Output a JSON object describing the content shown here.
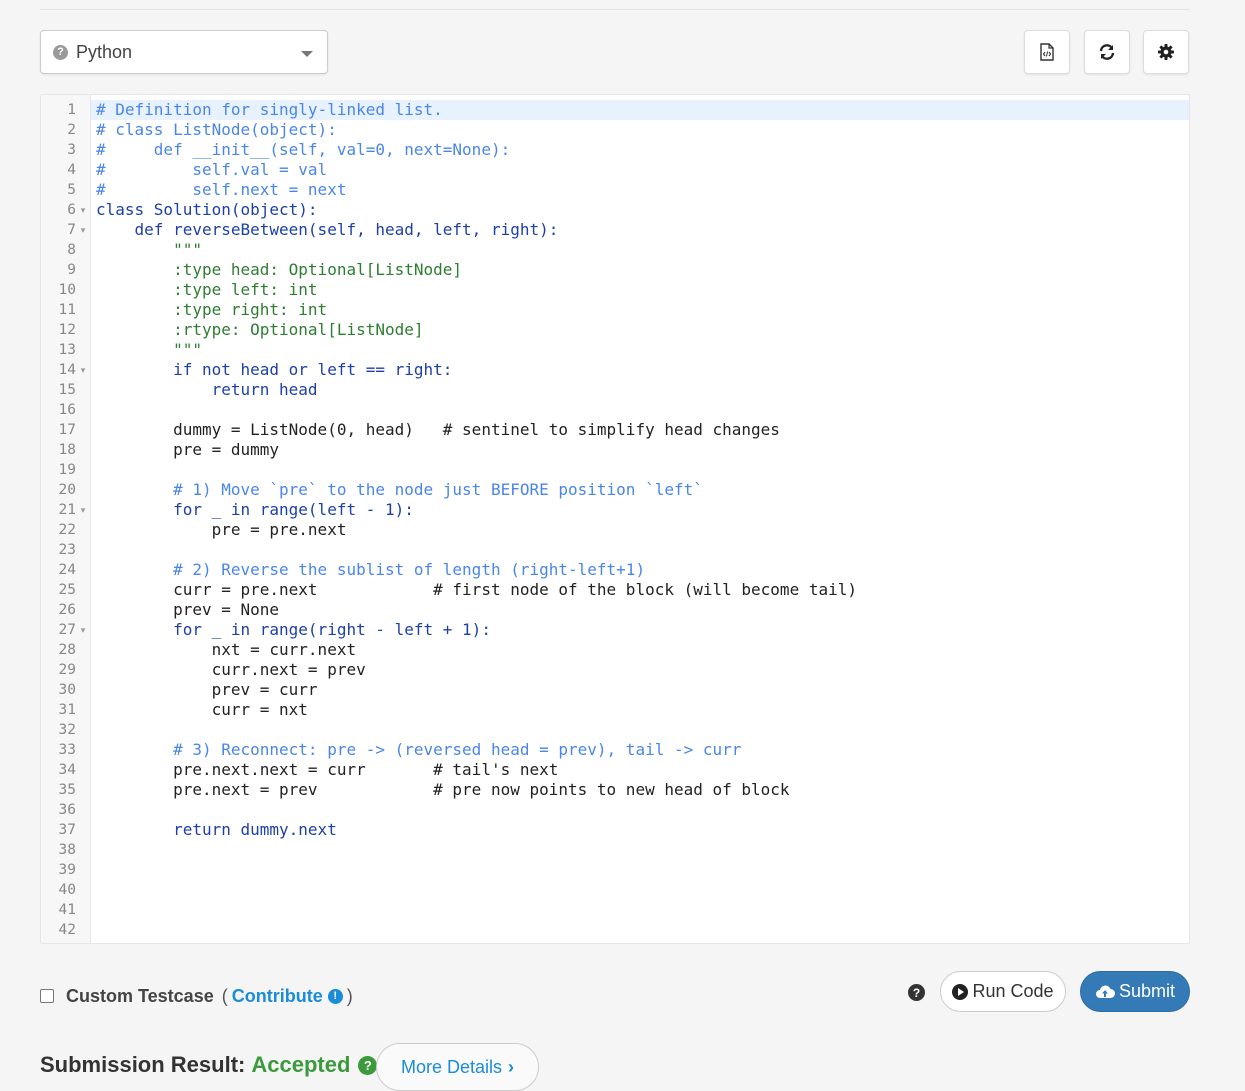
{
  "language": {
    "selected": "Python",
    "icon": "question-circle-icon"
  },
  "toolbar": {
    "icons": [
      "code-file-icon",
      "refresh-icon",
      "gear-icon"
    ]
  },
  "editor": {
    "line_numbers": [
      "1",
      "2",
      "3",
      "4",
      "5",
      "6",
      "7",
      "8",
      "9",
      "10",
      "11",
      "12",
      "13",
      "14",
      "15",
      "16",
      "17",
      "18",
      "19",
      "20",
      "21",
      "22",
      "23",
      "24",
      "25",
      "26",
      "27",
      "28",
      "29",
      "30",
      "31",
      "32",
      "33",
      "34",
      "35",
      "36",
      "37",
      "38",
      "39",
      "40",
      "41",
      "42"
    ],
    "fold_markers": {
      "6": "▾",
      "7": "▾",
      "14": "▾",
      "21": "▾",
      "27": "▾"
    },
    "lines": [
      "# Definition for singly-linked list.",
      "# class ListNode(object):",
      "#     def __init__(self, val=0, next=None):",
      "#         self.val = val",
      "#         self.next = next",
      "class Solution(object):",
      "    def reverseBetween(self, head, left, right):",
      "        \"\"\"",
      "        :type head: Optional[ListNode]",
      "        :type left: int",
      "        :type right: int",
      "        :rtype: Optional[ListNode]",
      "        \"\"\"",
      "        if not head or left == right:",
      "            return head",
      "",
      "        dummy = ListNode(0, head)   # sentinel to simplify head changes",
      "        pre = dummy",
      "",
      "        # 1) Move `pre` to the node just BEFORE position `left`",
      "        for _ in range(left - 1):",
      "            pre = pre.next",
      "",
      "        # 2) Reverse the sublist of length (right-left+1)",
      "        curr = pre.next            # first node of the block (will become tail)",
      "        prev = None",
      "        for _ in range(right - left + 1):",
      "            nxt = curr.next",
      "            curr.next = prev",
      "            prev = curr",
      "            curr = nxt",
      "",
      "        # 3) Reconnect: pre -> (reversed head = prev), tail -> curr",
      "        pre.next.next = curr       # tail's next",
      "        pre.next = prev            # pre now points to new head of block",
      "",
      "        return dummy.next",
      "",
      "",
      "",
      "",
      ""
    ]
  },
  "custom_testcase": {
    "label": "Custom Testcase",
    "open_paren": "(",
    "contribute": "Contribute",
    "close_paren": ")"
  },
  "actions": {
    "run_label": "Run Code",
    "submit_label": "Submit"
  },
  "result": {
    "label": "Submission Result:",
    "value": "Accepted",
    "more_details": "More Details"
  },
  "colors": {
    "accent": "#337ab7",
    "success": "#3c9a3c",
    "link": "#1a8cd8"
  }
}
